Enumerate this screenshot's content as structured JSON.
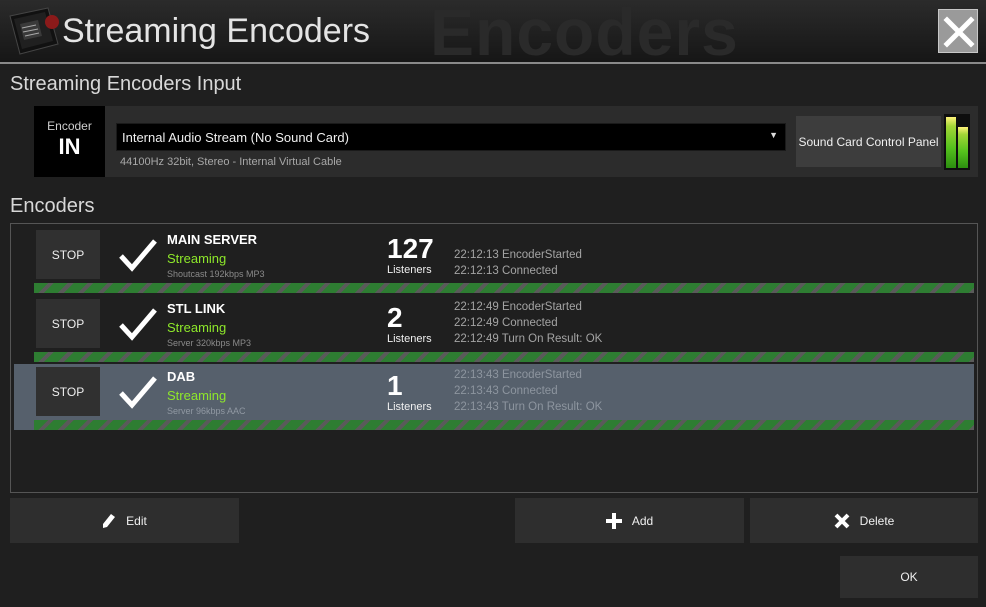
{
  "window": {
    "title": "Streaming Encoders",
    "watermark": "Encoders"
  },
  "input_section": {
    "title": "Streaming Encoders Input",
    "encoder_label": "Encoder",
    "encoder_value": "IN",
    "source_value": "Internal Audio Stream (No Sound Card)",
    "source_info": "44100Hz 32bit,  Stereo - Internal Virtual Cable",
    "sound_card_button": "Sound Card Control Panel",
    "meter_levels": [
      0.98,
      0.78
    ]
  },
  "encoders_section": {
    "title": "Encoders",
    "rows": [
      {
        "stop_label": "STOP",
        "name": "MAIN SERVER",
        "state": "Streaming",
        "format": "Shoutcast 192kbps MP3",
        "count": "127",
        "count_label": "Listeners",
        "log": [
          "22:12:13 EncoderStarted",
          "22:12:13 Connected"
        ],
        "selected": false
      },
      {
        "stop_label": "STOP",
        "name": "STL LINK",
        "state": "Streaming",
        "format": "Server 320kbps MP3",
        "count": "2",
        "count_label": "Listeners",
        "log": [
          "22:12:49 EncoderStarted",
          "22:12:49 Connected",
          "22:12:49 Turn On Result: OK"
        ],
        "selected": false
      },
      {
        "stop_label": "STOP",
        "name": "DAB",
        "state": "Streaming",
        "format": "Server 96kbps AAC",
        "count": "1",
        "count_label": "Listeners",
        "log": [
          "22:13:43 EncoderStarted",
          "22:13:43 Connected",
          "22:13:43 Turn On Result: OK"
        ],
        "selected": true
      }
    ]
  },
  "buttons": {
    "edit": "Edit",
    "add": "Add",
    "delete": "Delete",
    "ok": "OK"
  },
  "colors": {
    "streaming_text": "#8ee82a",
    "selected_row": "#56606c",
    "stripe_green": "#2e7d32"
  },
  "icons": {
    "logo": "app-logo-icon",
    "close": "close-icon",
    "dropdown": "chevron-down-icon",
    "check": "checkmark-icon",
    "edit": "pencil-icon",
    "add": "plus-icon",
    "delete": "x-icon"
  }
}
